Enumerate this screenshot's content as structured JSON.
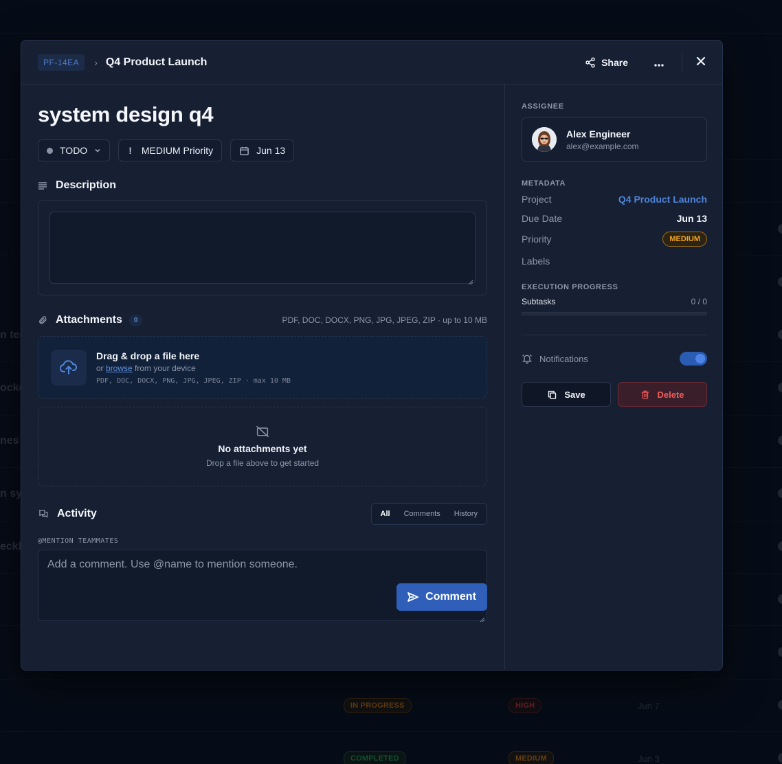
{
  "colors": {
    "accent": "#2f5fb8",
    "danger": "#ef5a5a",
    "warning": "#f3a521",
    "modal_bg": "#172033"
  },
  "background_list": {
    "side_texts": [
      "n tem",
      "ocker",
      "nes",
      "n sy",
      "eckli"
    ],
    "rows": [
      {
        "status": "IN PROGRESS",
        "status_color": "#b86a12",
        "priority": "HIGH",
        "priority_color": "#c23a3a",
        "date": "Jun 7"
      },
      {
        "status": "COMPLETED",
        "status_color": "#1f8a4c",
        "priority": "MEDIUM",
        "priority_color": "#b86a12",
        "date": "Jun 3"
      }
    ]
  },
  "header": {
    "task_id": "PF-14EA",
    "breadcrumb_separator": "›",
    "project": "Q4 Product Launch",
    "share_label": "Share",
    "more_icon": "more-horizontal-icon",
    "close_icon": "close-icon"
  },
  "task": {
    "title": "system design q4",
    "status": "TODO",
    "priority": "MEDIUM Priority",
    "due": "Jun 13"
  },
  "description": {
    "heading": "Description",
    "value": ""
  },
  "attachments": {
    "heading": "Attachments",
    "count": "0",
    "formats": "PDF, DOC, DOCX, PNG, JPG, JPEG, ZIP · up to 10 MB",
    "drop_title": "Drag & drop a file here",
    "drop_or": "or",
    "drop_browse": "browse",
    "drop_suffix": "from your device",
    "drop_formats": "PDF, DOC, DOCX, PNG, JPG, JPEG, ZIP · max 10 MB",
    "empty_title": "No attachments yet",
    "empty_sub": "Drop a file above to get started"
  },
  "activity": {
    "heading": "Activity",
    "tabs": [
      "All",
      "Comments",
      "History"
    ],
    "active_tab": "All",
    "mention_label": "@MENTION TEAMMATES",
    "comment_placeholder": "Add a comment. Use @name to mention someone.",
    "comment_button": "Comment"
  },
  "sidebar": {
    "assignee_label": "ASSIGNEE",
    "assignee_name": "Alex Engineer",
    "assignee_email": "alex@example.com",
    "metadata_label": "METADATA",
    "project_label": "Project",
    "project_value": "Q4 Product Launch",
    "due_label": "Due Date",
    "due_value": "Jun 13",
    "priority_label": "Priority",
    "priority_value": "MEDIUM",
    "labels_label": "Labels",
    "progress_label": "EXECUTION PROGRESS",
    "subtasks_label": "Subtasks",
    "subtasks_value": "0 / 0",
    "progress_fraction": 0,
    "notifications_label": "Notifications",
    "notifications_on": true,
    "save_label": "Save",
    "delete_label": "Delete"
  }
}
